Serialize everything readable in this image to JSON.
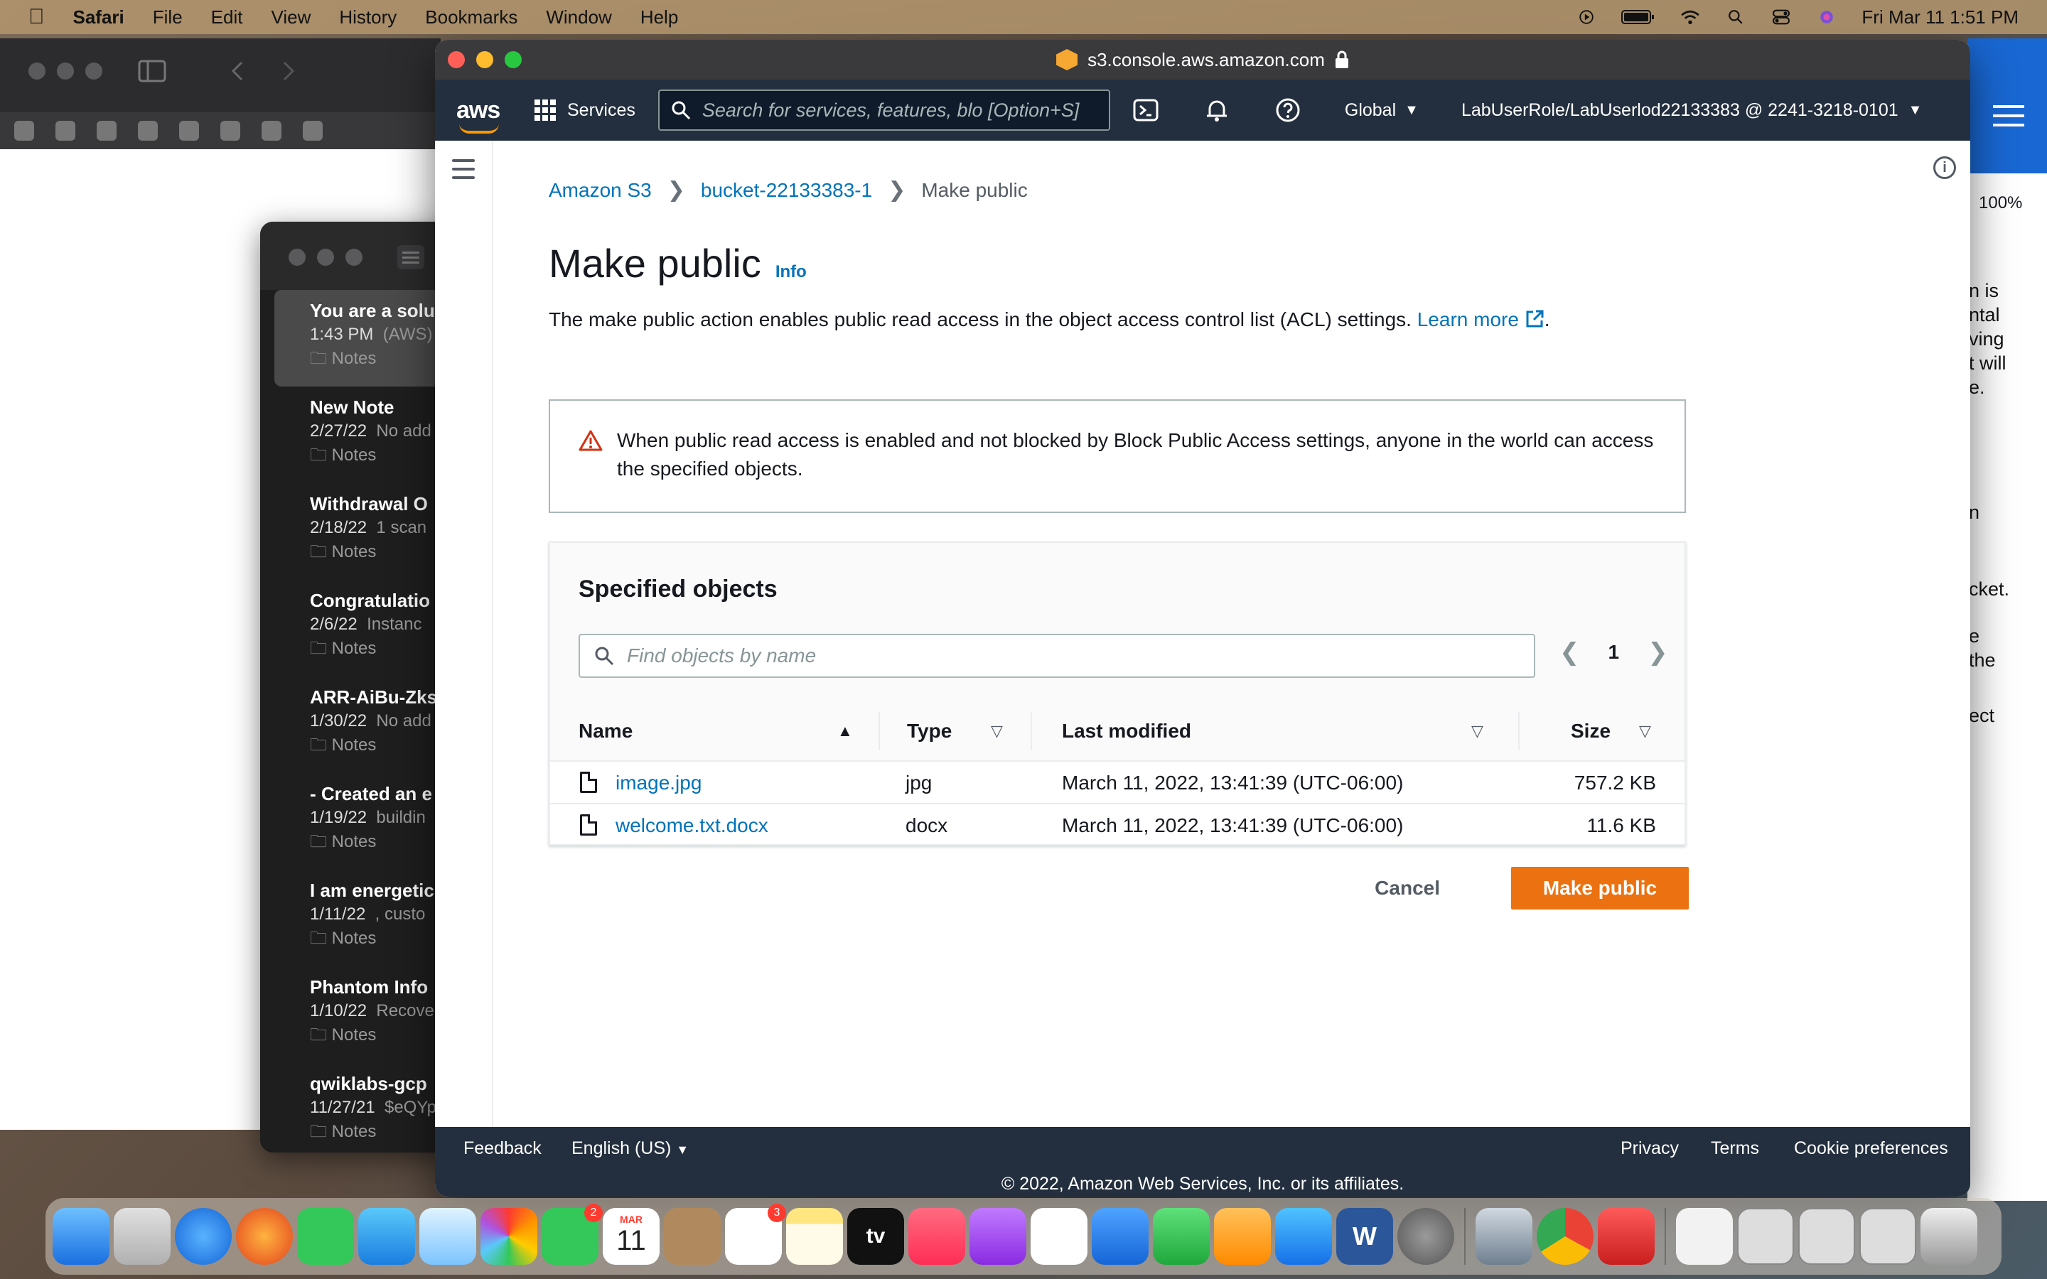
{
  "menubar": {
    "app": "Safari",
    "items": [
      "File",
      "Edit",
      "View",
      "History",
      "Bookmarks",
      "Window",
      "Help"
    ],
    "datetime": "Fri Mar 11  1:51 PM"
  },
  "browser": {
    "url": "s3.console.aws.amazon.com",
    "zoom": "100%"
  },
  "aws_nav": {
    "logo": "aws",
    "services_label": "Services",
    "search_placeholder": "Search for services, features, blo [Option+S]",
    "region": "Global",
    "account": "LabUserRole/LabUserlod22133383 @ 2241-3218-0101"
  },
  "breadcrumb": {
    "root": "Amazon S3",
    "bucket": "bucket-22133383-1",
    "current": "Make public"
  },
  "page": {
    "title": "Make public",
    "info_label": "Info",
    "description": "The make public action enables public read access in the object access control list (ACL) settings.",
    "learn_more": "Learn more",
    "warning": "When public read access is enabled and not blocked by Block Public Access settings, anyone in the world can access the specified objects."
  },
  "objects_panel": {
    "title": "Specified objects",
    "search_placeholder": "Find objects by name",
    "page_number": "1",
    "columns": {
      "name": "Name",
      "type": "Type",
      "modified": "Last modified",
      "size": "Size"
    },
    "rows": [
      {
        "name": "image.jpg",
        "type": "jpg",
        "modified": "March 11, 2022, 13:41:39 (UTC-06:00)",
        "size": "757.2 KB"
      },
      {
        "name": "welcome.txt.docx",
        "type": "docx",
        "modified": "March 11, 2022, 13:41:39 (UTC-06:00)",
        "size": "11.6 KB"
      }
    ]
  },
  "actions": {
    "cancel": "Cancel",
    "confirm": "Make public"
  },
  "footer": {
    "feedback": "Feedback",
    "language": "English (US)",
    "privacy": "Privacy",
    "terms": "Terms",
    "cookies": "Cookie preferences",
    "copyright": "© 2022, Amazon Web Services, Inc. or its affiliates."
  },
  "notes": [
    {
      "title": "You are a solu",
      "date": "1:43 PM",
      "sub": "(AWS)",
      "folder": "Notes"
    },
    {
      "title": "New Note",
      "date": "2/27/22",
      "sub": "No add",
      "folder": "Notes"
    },
    {
      "title": "Withdrawal O",
      "date": "2/18/22",
      "sub": "1 scan",
      "folder": "Notes"
    },
    {
      "title": "Congratulatio",
      "date": "2/6/22",
      "sub": "Instanc",
      "folder": "Notes"
    },
    {
      "title": "ARR-AiBu-Zks",
      "date": "1/30/22",
      "sub": "No add",
      "folder": "Notes"
    },
    {
      "title": "- Created an e",
      "date": "1/19/22",
      "sub": "buildin",
      "folder": "Notes"
    },
    {
      "title": "I am energetic",
      "date": "1/11/22",
      "sub": ", custo",
      "folder": "Notes"
    },
    {
      "title": "Phantom Info",
      "date": "1/10/22",
      "sub": "Recove",
      "folder": "Notes"
    },
    {
      "title": "qwiklabs-gcp",
      "date": "11/27/21",
      "sub": "$eQYp",
      "folder": "Notes"
    }
  ],
  "right_window_text": {
    "lines1": [
      "n is",
      "ntal",
      "ving",
      "t will",
      "e."
    ],
    "line_n": "n",
    "line_cket": "cket.",
    "lines2": [
      "e",
      "the"
    ],
    "line_ect": "ect"
  },
  "dock": {
    "calendar_month": "MAR",
    "calendar_day": "11",
    "facetime_badge": "2",
    "reminders_badge": "3",
    "tv_label": "tv",
    "word_label": "W"
  },
  "colors": {
    "aws_nav": "#232f3e",
    "link": "#0073bb",
    "primary_button": "#ec7211",
    "warning": "#d13212"
  }
}
